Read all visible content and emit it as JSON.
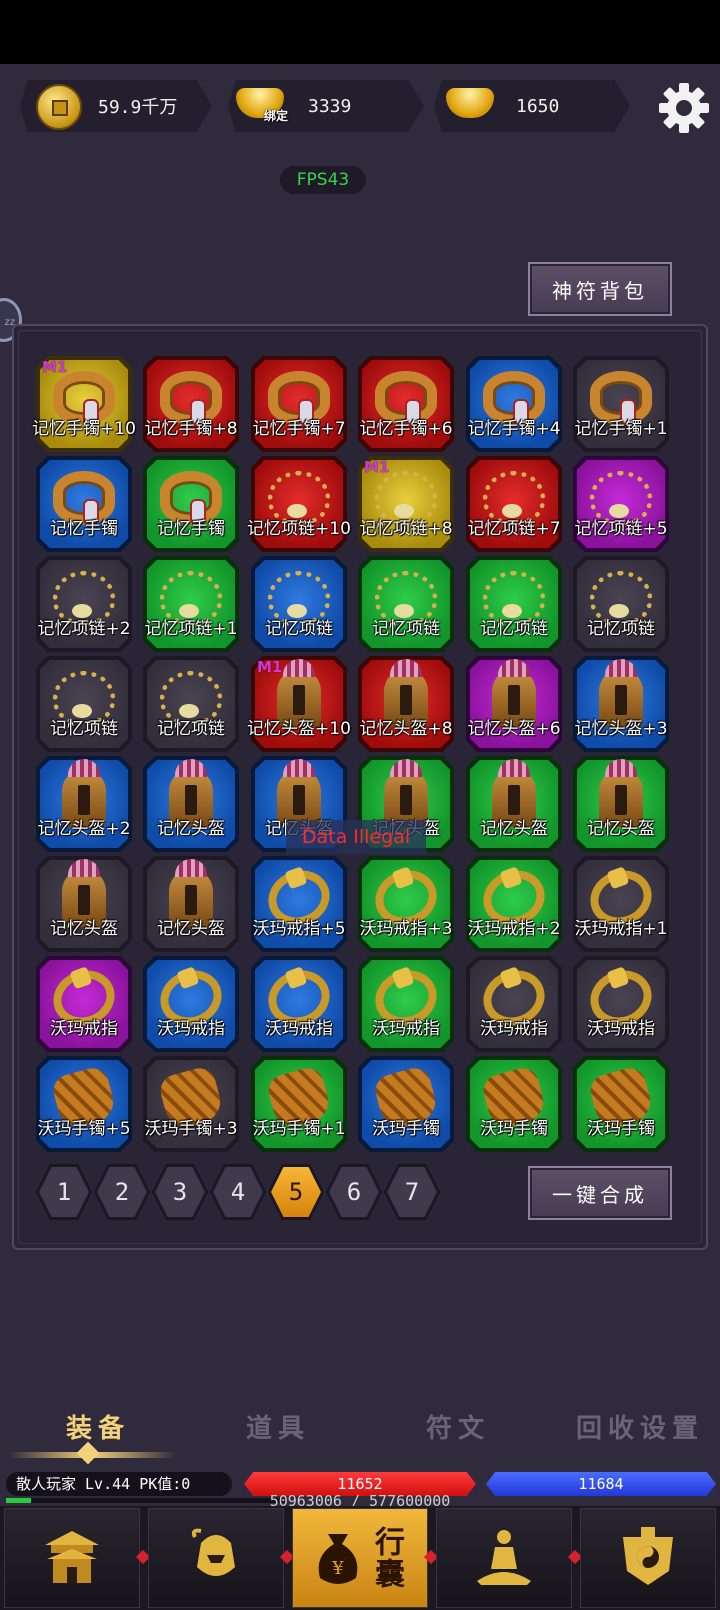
{
  "currency": {
    "copper": "59.9千万",
    "bound_gold_tag": "绑定",
    "bound_gold": "3339",
    "gold": "1650"
  },
  "fps": "FPS43",
  "rune_bag_label": "神符背包",
  "items": [
    {
      "label": "记忆手镯+10",
      "quality": "yellow",
      "type": "bracelet",
      "badge": "M1"
    },
    {
      "label": "记忆手镯+8",
      "quality": "red",
      "type": "bracelet",
      "badge": ""
    },
    {
      "label": "记忆手镯+7",
      "quality": "red",
      "type": "bracelet",
      "badge": ""
    },
    {
      "label": "记忆手镯+6",
      "quality": "red",
      "type": "bracelet",
      "badge": ""
    },
    {
      "label": "记忆手镯+4",
      "quality": "blue",
      "type": "bracelet",
      "badge": ""
    },
    {
      "label": "记忆手镯+1",
      "quality": "gray",
      "type": "bracelet",
      "badge": ""
    },
    {
      "label": "记忆手镯",
      "quality": "blue",
      "type": "bracelet",
      "badge": ""
    },
    {
      "label": "记忆手镯",
      "quality": "green",
      "type": "bracelet",
      "badge": ""
    },
    {
      "label": "记忆项链+10",
      "quality": "red",
      "type": "necklace",
      "badge": ""
    },
    {
      "label": "记忆项链+8",
      "quality": "yellow",
      "type": "necklace",
      "badge": "M1"
    },
    {
      "label": "记忆项链+7",
      "quality": "red",
      "type": "necklace",
      "badge": ""
    },
    {
      "label": "记忆项链+5",
      "quality": "purple",
      "type": "necklace",
      "badge": ""
    },
    {
      "label": "记忆项链+2",
      "quality": "gray",
      "type": "necklace",
      "badge": ""
    },
    {
      "label": "记忆项链+1",
      "quality": "green",
      "type": "necklace",
      "badge": ""
    },
    {
      "label": "记忆项链",
      "quality": "blue",
      "type": "necklace",
      "badge": ""
    },
    {
      "label": "记忆项链",
      "quality": "green",
      "type": "necklace",
      "badge": ""
    },
    {
      "label": "记忆项链",
      "quality": "green",
      "type": "necklace",
      "badge": ""
    },
    {
      "label": "记忆项链",
      "quality": "gray",
      "type": "necklace",
      "badge": ""
    },
    {
      "label": "记忆项链",
      "quality": "gray",
      "type": "necklace",
      "badge": ""
    },
    {
      "label": "记忆项链",
      "quality": "gray",
      "type": "necklace",
      "badge": ""
    },
    {
      "label": "记忆头盔+10",
      "quality": "red",
      "type": "helmet",
      "badge": "M1"
    },
    {
      "label": "记忆头盔+8",
      "quality": "red",
      "type": "helmet",
      "badge": ""
    },
    {
      "label": "记忆头盔+6",
      "quality": "purple",
      "type": "helmet",
      "badge": ""
    },
    {
      "label": "记忆头盔+3",
      "quality": "blue",
      "type": "helmet",
      "badge": ""
    },
    {
      "label": "记忆头盔+2",
      "quality": "blue",
      "type": "helmet",
      "badge": ""
    },
    {
      "label": "记忆头盔",
      "quality": "blue",
      "type": "helmet",
      "badge": ""
    },
    {
      "label": "记忆头盔",
      "quality": "blue",
      "type": "helmet",
      "badge": ""
    },
    {
      "label": "记忆头盔",
      "quality": "green",
      "type": "helmet",
      "badge": ""
    },
    {
      "label": "记忆头盔",
      "quality": "green",
      "type": "helmet",
      "badge": ""
    },
    {
      "label": "记忆头盔",
      "quality": "green",
      "type": "helmet",
      "badge": ""
    },
    {
      "label": "记忆头盔",
      "quality": "gray",
      "type": "helmet",
      "badge": ""
    },
    {
      "label": "记忆头盔",
      "quality": "gray",
      "type": "helmet",
      "badge": ""
    },
    {
      "label": "沃玛戒指+5",
      "quality": "blue",
      "type": "ring",
      "badge": ""
    },
    {
      "label": "沃玛戒指+3",
      "quality": "green",
      "type": "ring",
      "badge": ""
    },
    {
      "label": "沃玛戒指+2",
      "quality": "green",
      "type": "ring",
      "badge": ""
    },
    {
      "label": "沃玛戒指+1",
      "quality": "gray",
      "type": "ring",
      "badge": ""
    },
    {
      "label": "沃玛戒指",
      "quality": "purple",
      "type": "ring",
      "badge": ""
    },
    {
      "label": "沃玛戒指",
      "quality": "blue",
      "type": "ring",
      "badge": ""
    },
    {
      "label": "沃玛戒指",
      "quality": "blue",
      "type": "ring",
      "badge": ""
    },
    {
      "label": "沃玛戒指",
      "quality": "green",
      "type": "ring",
      "badge": ""
    },
    {
      "label": "沃玛戒指",
      "quality": "gray",
      "type": "ring",
      "badge": ""
    },
    {
      "label": "沃玛戒指",
      "quality": "gray",
      "type": "ring",
      "badge": ""
    },
    {
      "label": "沃玛手镯+5",
      "quality": "blue",
      "type": "glove",
      "badge": ""
    },
    {
      "label": "沃玛手镯+3",
      "quality": "gray",
      "type": "glove",
      "badge": ""
    },
    {
      "label": "沃玛手镯+1",
      "quality": "green",
      "type": "glove",
      "badge": ""
    },
    {
      "label": "沃玛手镯",
      "quality": "blue",
      "type": "glove",
      "badge": ""
    },
    {
      "label": "沃玛手镯",
      "quality": "green",
      "type": "glove",
      "badge": ""
    },
    {
      "label": "沃玛手镯",
      "quality": "green",
      "type": "glove",
      "badge": ""
    }
  ],
  "toast": "Data Illegal",
  "pages": [
    "1",
    "2",
    "3",
    "4",
    "5",
    "6",
    "7"
  ],
  "active_page": "5",
  "merge_all_label": "一键合成",
  "tabs": [
    {
      "label": "装备",
      "active": true
    },
    {
      "label": "道具",
      "active": false
    },
    {
      "label": "符文",
      "active": false
    },
    {
      "label": "回收设置",
      "active": false
    }
  ],
  "player": {
    "info": "散人玩家  Lv.44 PK值:0",
    "hp": "11652",
    "mp": "11684",
    "exp": "50963006 / 577600000",
    "exp_fraction": 0.088
  },
  "nav": {
    "bag_label": "行囊",
    "items": [
      "city-icon",
      "warrior-helmet-icon",
      "bag-icon",
      "meditation-icon",
      "taiji-armor-icon"
    ]
  },
  "colors": {
    "background": "#2f2a3c",
    "accent_gold": "#f3d27a",
    "hp": "#e82020",
    "mp": "#3050f0",
    "fps": "#36d44a",
    "toast": "#ff2a2a"
  }
}
